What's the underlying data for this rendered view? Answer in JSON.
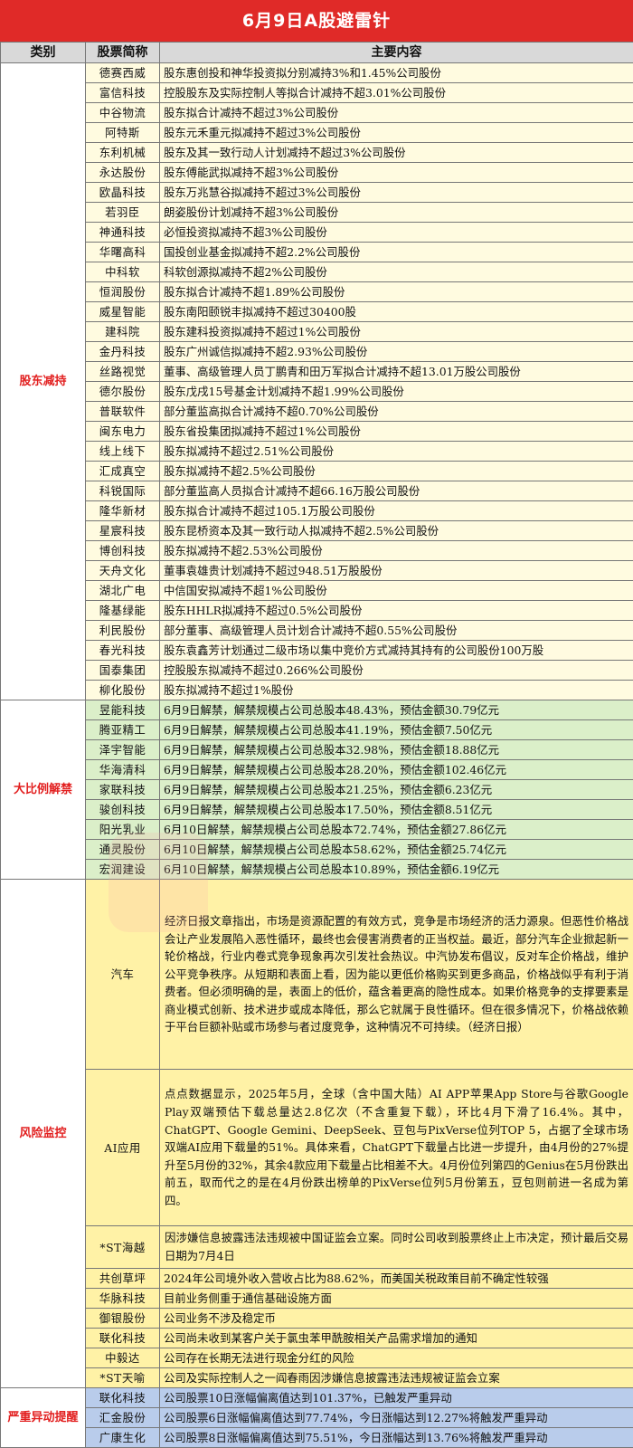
{
  "title": "6月9日A股避雷针",
  "headers": {
    "category": "类别",
    "name": "股票简称",
    "content": "主要内容"
  },
  "sections": {
    "reduce": {
      "category": "股东减持",
      "rows": [
        {
          "name": "德赛西威",
          "content": "股东惠创投和神华投资拟分别减持3%和1.45%公司股份"
        },
        {
          "name": "富信科技",
          "content": "控股股东及实际控制人等拟合计减持不超3.01%公司股份"
        },
        {
          "name": "中谷物流",
          "content": "股东拟合计减持不超过3%公司股份"
        },
        {
          "name": "阿特斯",
          "content": "股东元禾重元拟减持不超过3%公司股份"
        },
        {
          "name": "东利机械",
          "content": "股东及其一致行动人计划减持不超过3%公司股份"
        },
        {
          "name": "永达股份",
          "content": "股东傅能武拟减持不超3%公司股份"
        },
        {
          "name": "欧晶科技",
          "content": "股东万兆慧谷拟减持不超过3%公司股份"
        },
        {
          "name": "若羽臣",
          "content": "朗姿股份计划减持不超3%公司股份"
        },
        {
          "name": "神通科技",
          "content": "必恒投资拟减持不超3%公司股份"
        },
        {
          "name": "华曙高科",
          "content": "国投创业基金拟减持不超2.2%公司股份"
        },
        {
          "name": "中科软",
          "content": "科软创源拟减持不超2%公司股份"
        },
        {
          "name": "恒润股份",
          "content": "股东拟合计减持不超1.89%公司股份"
        },
        {
          "name": "威星智能",
          "content": "股东南阳颐锐丰拟减持不超过30400股"
        },
        {
          "name": "建科院",
          "content": "股东建科投资拟减持不超过1%公司股份"
        },
        {
          "name": "金丹科技",
          "content": "股东广州诚信拟减持不超2.93%公司股份"
        },
        {
          "name": "丝路视觉",
          "content": "董事、高级管理人员丁鹏青和田万军拟合计减持不超13.01万股公司股份"
        },
        {
          "name": "德尔股份",
          "content": "股东戊戌15号基金计划减持不超1.99%公司股份"
        },
        {
          "name": "普联软件",
          "content": "部分董监高拟合计减持不超0.70%公司股份"
        },
        {
          "name": "闽东电力",
          "content": "股东省投集团拟减持不超过1%公司股份"
        },
        {
          "name": "线上线下",
          "content": "股东拟减持不超过2.51%公司股份"
        },
        {
          "name": "汇成真空",
          "content": "股东拟减持不超2.5%公司股份"
        },
        {
          "name": "科锐国际",
          "content": "部分董监高人员拟合计减持不超66.16万股公司股份"
        },
        {
          "name": "隆华新材",
          "content": "股东拟合计减持不超过105.1万股公司股份"
        },
        {
          "name": "星宸科技",
          "content": "股东昆桥资本及其一致行动人拟减持不超2.5%公司股份"
        },
        {
          "name": "博创科技",
          "content": "股东拟减持不超2.53%公司股份"
        },
        {
          "name": "天舟文化",
          "content": "董事袁雄贵计划减持不超过948.51万股股份"
        },
        {
          "name": "湖北广电",
          "content": "中信国安拟减持不超1%公司股份"
        },
        {
          "name": "隆基绿能",
          "content": "股东HHLR拟减持不超过0.5%公司股份"
        },
        {
          "name": "利民股份",
          "content": "部分董事、高级管理人员计划合计减持不超0.55%公司股份"
        },
        {
          "name": "春光科技",
          "content": "股东袁鑫芳计划通过二级市场以集中竞价方式减持其持有的公司股份100万股"
        },
        {
          "name": "国泰集团",
          "content": "控股股东拟减持不超过0.266%公司股份"
        },
        {
          "name": "柳化股份",
          "content": "股东拟减持不超过1%股份"
        }
      ]
    },
    "unlock": {
      "category": "大比例解禁",
      "rows": [
        {
          "name": "昱能科技",
          "content": "6月9日解禁，解禁规模占公司总股本48.43%，预估金额30.79亿元"
        },
        {
          "name": "腾亚精工",
          "content": "6月9日解禁，解禁规模占公司总股本41.19%，预估金额7.50亿元"
        },
        {
          "name": "泽宇智能",
          "content": "6月9日解禁，解禁规模占公司总股本32.98%，预估金额18.88亿元"
        },
        {
          "name": "华海清科",
          "content": "6月9日解禁，解禁规模占公司总股本28.20%，预估金额102.46亿元"
        },
        {
          "name": "家联科技",
          "content": "6月9日解禁，解禁规模占公司总股本21.25%，预估金额6.23亿元"
        },
        {
          "name": "骏创科技",
          "content": "6月9日解禁，解禁规模占公司总股本17.50%，预估金额8.51亿元"
        },
        {
          "name": "阳光乳业",
          "content": "6月10日解禁，解禁规模占公司总股本72.74%，预估金额27.86亿元"
        },
        {
          "name": "通灵股份",
          "content": "6月10日解禁，解禁规模占公司总股本58.62%，预估金额25.74亿元"
        },
        {
          "name": "宏润建设",
          "content": "6月10日解禁，解禁规模占公司总股本10.89%，预估金额6.19亿元"
        }
      ]
    },
    "risk": {
      "category": "风险监控",
      "rows": [
        {
          "name": "汽车",
          "content": "经济日报文章指出，市场是资源配置的有效方式，竞争是市场经济的活力源泉。但恶性价格战会让产业发展陷入恶性循环，最终也会侵害消费者的正当权益。最近，部分汽车企业掀起新一轮价格战，行业内卷式竞争现象再次引发社会热议。中汽协发布倡议，反对车企价格战，维护公平竞争秩序。从短期和表面上看，因为能以更低价格购买到更多商品，价格战似乎有利于消费者。但必须明确的是，表面上的低价，蕴含着更高的隐性成本。如果价格竞争的支撑要素是商业模式创新、技术进步或成本降低，那么它就属于良性循环。但在很多情况下，价格战依赖于平台巨额补贴或市场参与者过度竞争，这种情况不可持续。（经济日报）"
        },
        {
          "name": "AI应用",
          "content": "点点数据显示，2025年5月，全球（含中国大陆）AI APP苹果App Store与谷歌Google Play双端预估下载总量达2.8亿次（不含重复下载），环比4月下滑了16.4%。其中，ChatGPT、Google Gemini、DeepSeek、豆包与PixVerse位列TOP 5，占据了全球市场双端AI应用下载量的51%。具体来看，ChatGPT下载量占比进一步提升，由4月份的27%提升至5月份的32%，其余4款应用下载量占比相差不大。4月份位列第四的Genius在5月份跌出前五，取而代之的是在4月份跌出榜单的PixVerse位列5月份第五，豆包则前进一名成为第四。"
        },
        {
          "name": "*ST海越",
          "content": "因涉嫌信息披露违法违规被中国证监会立案。同时公司收到股票终止上市决定，预计最后交易日期为7月4日"
        },
        {
          "name": "共创草坪",
          "content": "2024年公司境外收入营收占比为88.62%，而美国关税政策目前不确定性较强"
        },
        {
          "name": "华脉科技",
          "content": "目前业务侧重于通信基础设施方面"
        },
        {
          "name": "御银股份",
          "content": "公司业务不涉及稳定币"
        },
        {
          "name": "联化科技",
          "content": "公司尚未收到某客户关于氯虫苯甲酰胺相关产品需求增加的通知"
        },
        {
          "name": "中毅达",
          "content": "公司存在长期无法进行现金分红的风险"
        },
        {
          "name": "*ST天喻",
          "content": "公司及实际控制人之一阎春雨因涉嫌信息披露违法违规被证监会立案"
        }
      ]
    },
    "abnormal": {
      "category": "严重异动提醒",
      "rows": [
        {
          "name": "联化科技",
          "content": "公司股票10日涨幅偏离值达到101.37%，已触发严重异动"
        },
        {
          "name": "汇金股份",
          "content": "公司股票6日涨幅偏离值达到77.74%，今日涨幅达到12.27%将触发严重异动"
        },
        {
          "name": "广康生化",
          "content": "公司股票8日涨幅偏离值达到75.51%，今日涨幅达到13.76%将触发严重异动"
        }
      ]
    }
  }
}
